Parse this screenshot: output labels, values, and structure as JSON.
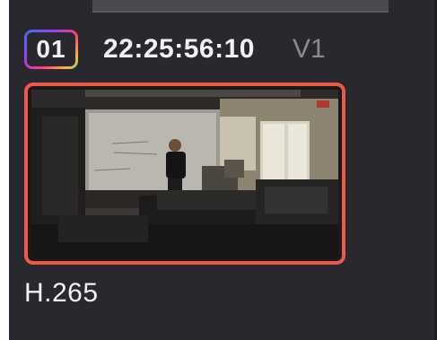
{
  "clip": {
    "number": "01",
    "timecode": "22:25:56:10",
    "track": "V1",
    "codec": "H.265",
    "selected": true,
    "thumbnail_icon": "video-thumbnail-icon"
  },
  "colors": {
    "panel_background": "#28282e",
    "selection_border": "#ee5a44",
    "primary_text": "#f2f2f2",
    "secondary_text": "#8a8a90"
  }
}
